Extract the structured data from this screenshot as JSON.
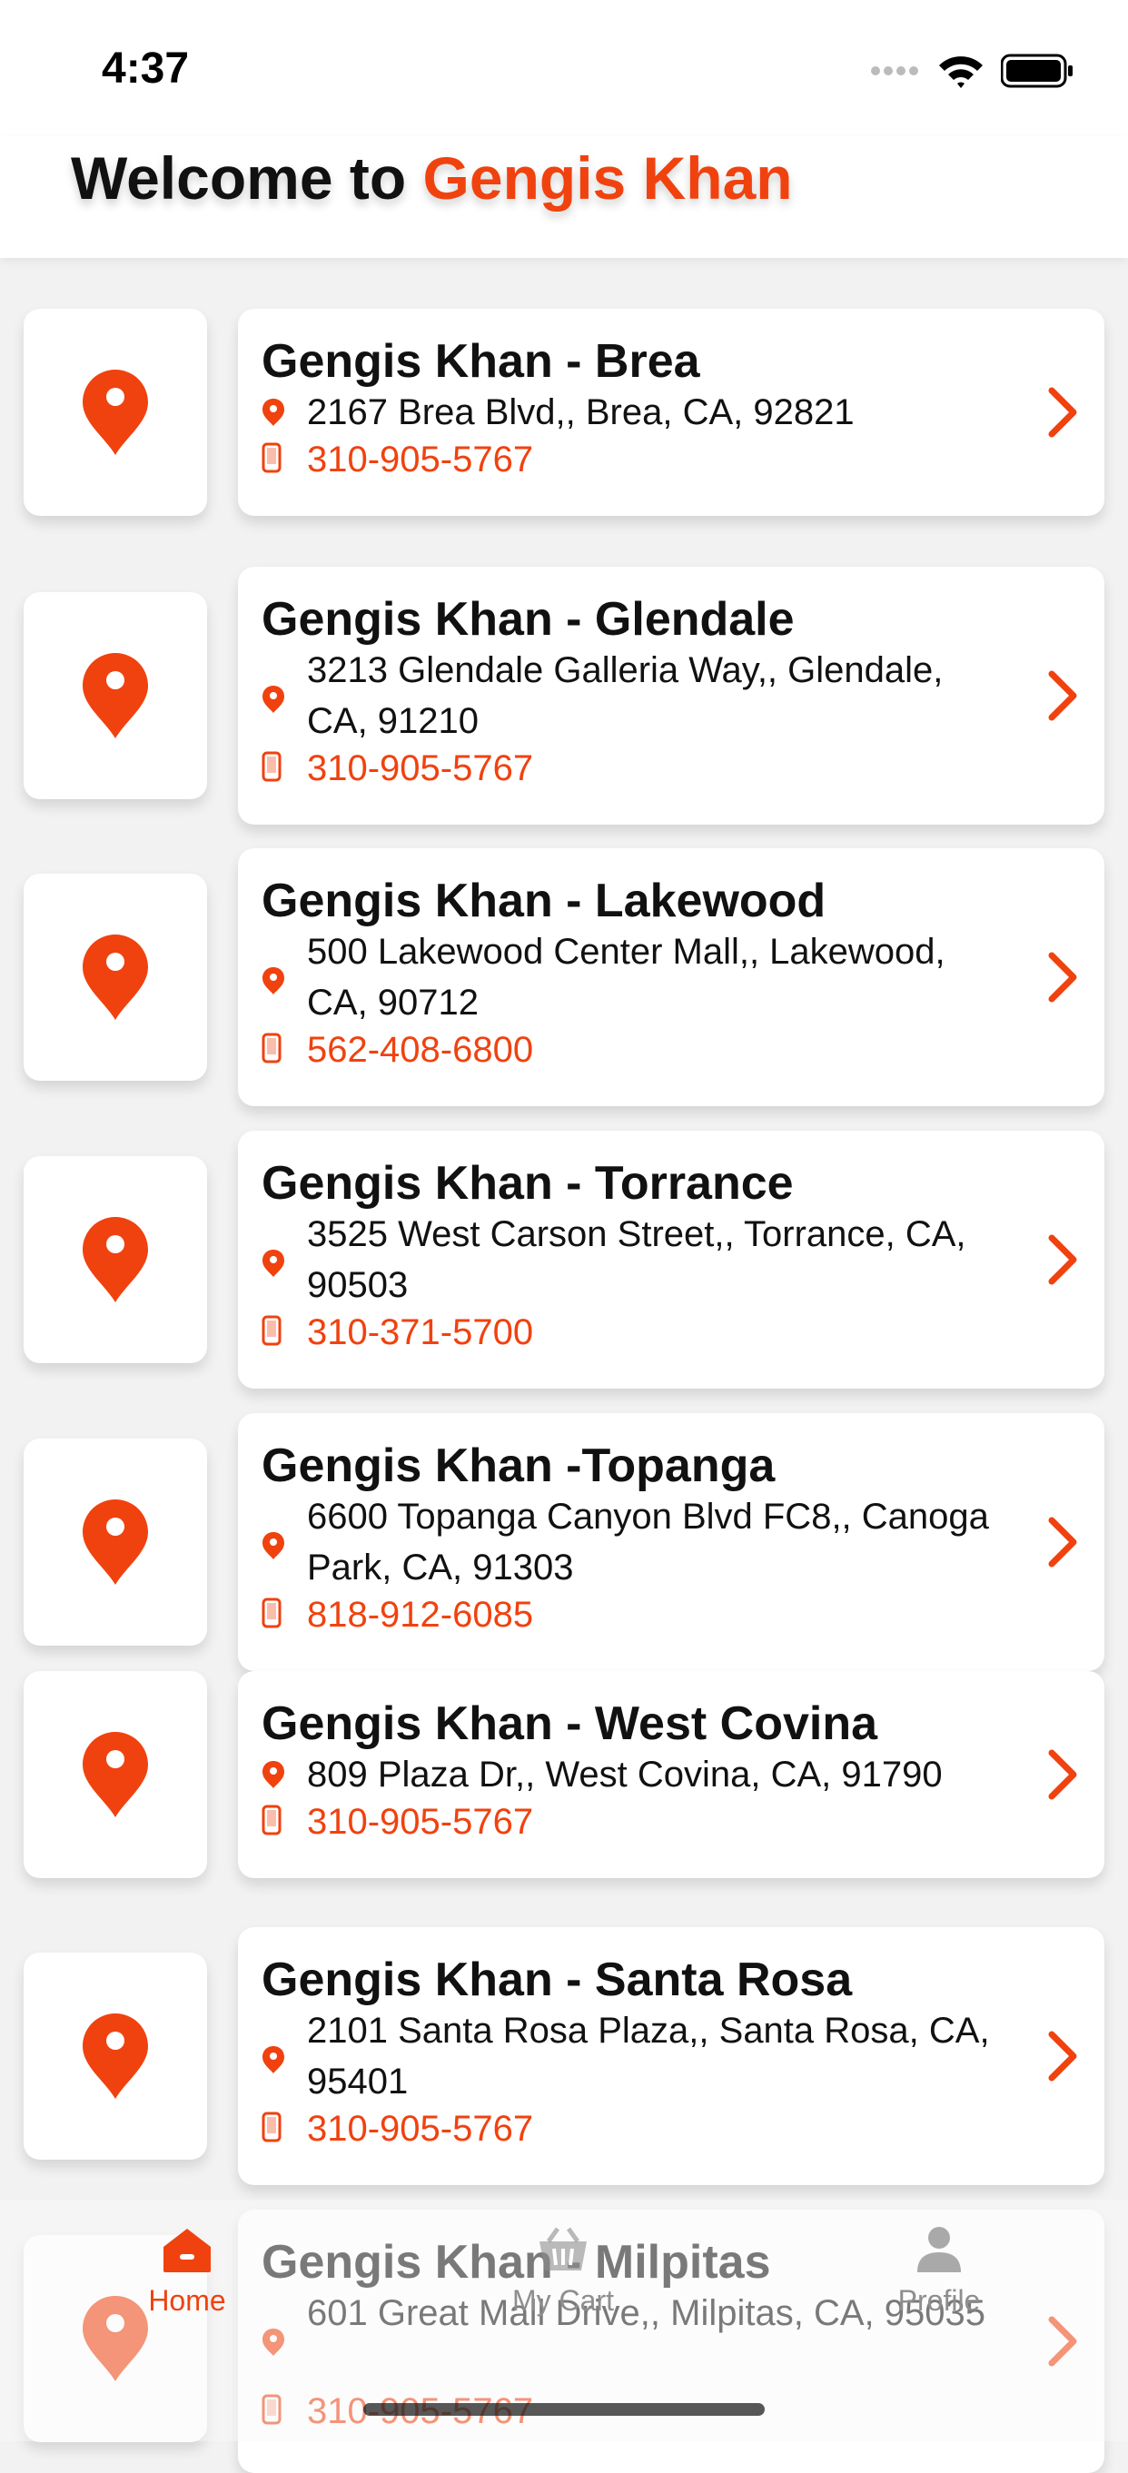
{
  "status_bar": {
    "time": "4:37"
  },
  "header": {
    "welcome_prefix": "Welcome to ",
    "brand": "Gengis Khan"
  },
  "colors": {
    "accent": "#f0420f",
    "text": "#111111",
    "background": "#f2f2f2",
    "inactive": "#8e8e8e"
  },
  "locations": [
    {
      "name": "Gengis Khan - Brea",
      "address": "2167 Brea Blvd,, Brea, CA, 92821",
      "phone": "310-905-5767"
    },
    {
      "name": "Gengis Khan - Glendale",
      "address": "3213 Glendale Galleria Way,, Glendale, CA, 91210",
      "phone": "310-905-5767"
    },
    {
      "name": "Gengis Khan - Lakewood",
      "address": "500 Lakewood Center Mall,, Lakewood, CA, 90712",
      "phone": "562-408-6800"
    },
    {
      "name": "Gengis Khan - Torrance",
      "address": "3525 West Carson Street,, Torrance, CA, 90503",
      "phone": "310-371-5700"
    },
    {
      "name": "Gengis Khan -Topanga",
      "address": "6600 Topanga Canyon Blvd FC8,, Canoga Park, CA, 91303",
      "phone": "818-912-6085"
    },
    {
      "name": "Gengis Khan - West Covina",
      "address": "809 Plaza Dr,, West Covina, CA, 91790",
      "phone": "310-905-5767"
    },
    {
      "name": "Gengis Khan - Santa Rosa",
      "address": "2101 Santa Rosa Plaza,, Santa Rosa, CA, 95401",
      "phone": "310-905-5767"
    },
    {
      "name": "Gengis Khan - Milpitas",
      "address": "601 Great Mall Drive,, Milpitas, CA, 95035",
      "phone": "310-905-5767"
    }
  ],
  "tabs": [
    {
      "label": "Home",
      "icon": "home-icon",
      "active": true
    },
    {
      "label": "My Cart",
      "icon": "basket-icon",
      "active": false
    },
    {
      "label": "Profile",
      "icon": "person-icon",
      "active": false
    }
  ]
}
